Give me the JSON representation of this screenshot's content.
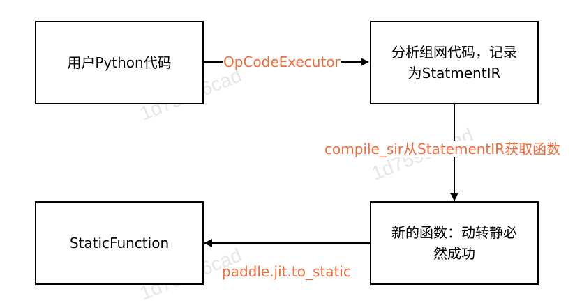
{
  "nodes": {
    "user_code": {
      "label": "用户Python代码"
    },
    "analyze": {
      "label_line1": "分析组网代码，记录",
      "label_line2": "为StatmentIR"
    },
    "new_function": {
      "label_line1": "新的函数：动转静必",
      "label_line2": "然成功"
    },
    "static_function": {
      "label": "StaticFunction"
    }
  },
  "edges": {
    "opcode_executor": {
      "label": "OpCodeExecutor"
    },
    "compile_sir": {
      "label": "compile_sir从StatementIR获取函数"
    },
    "to_static": {
      "label": "paddle.jit.to_static"
    }
  },
  "watermark": {
    "text": "1d75916cad"
  },
  "colors": {
    "edge_label": "#f26b3a",
    "stroke": "#000000",
    "watermark": "#e6e6e6"
  }
}
